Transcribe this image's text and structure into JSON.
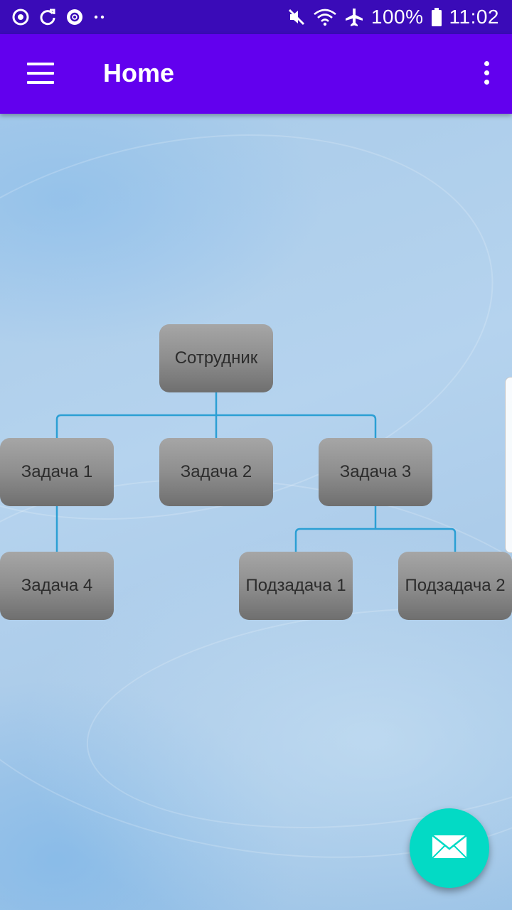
{
  "status_bar": {
    "left_icons": [
      "sync-icon",
      "refresh-icon",
      "settings-gear-icon",
      "more-dots-icon"
    ],
    "right_icons": [
      "mute-icon",
      "wifi-icon",
      "airplane-icon"
    ],
    "battery": "100%",
    "time": "11:02"
  },
  "app_bar": {
    "title": "Home",
    "menu_icon": "hamburger-icon",
    "overflow_icon": "overflow-menu-icon"
  },
  "tree": {
    "root": "Сотрудник",
    "level1": [
      "Задача 1",
      "Задача 2",
      "Задача 3"
    ],
    "level2": [
      "Задача 4",
      "Подзадача 1",
      "Подзадача 2"
    ]
  },
  "fab": {
    "icon": "mail-icon"
  },
  "colors": {
    "status_bar": "#3a0bb8",
    "app_bar": "#6200ee",
    "fab": "#03dac5",
    "connector": "#2b9fd4"
  }
}
